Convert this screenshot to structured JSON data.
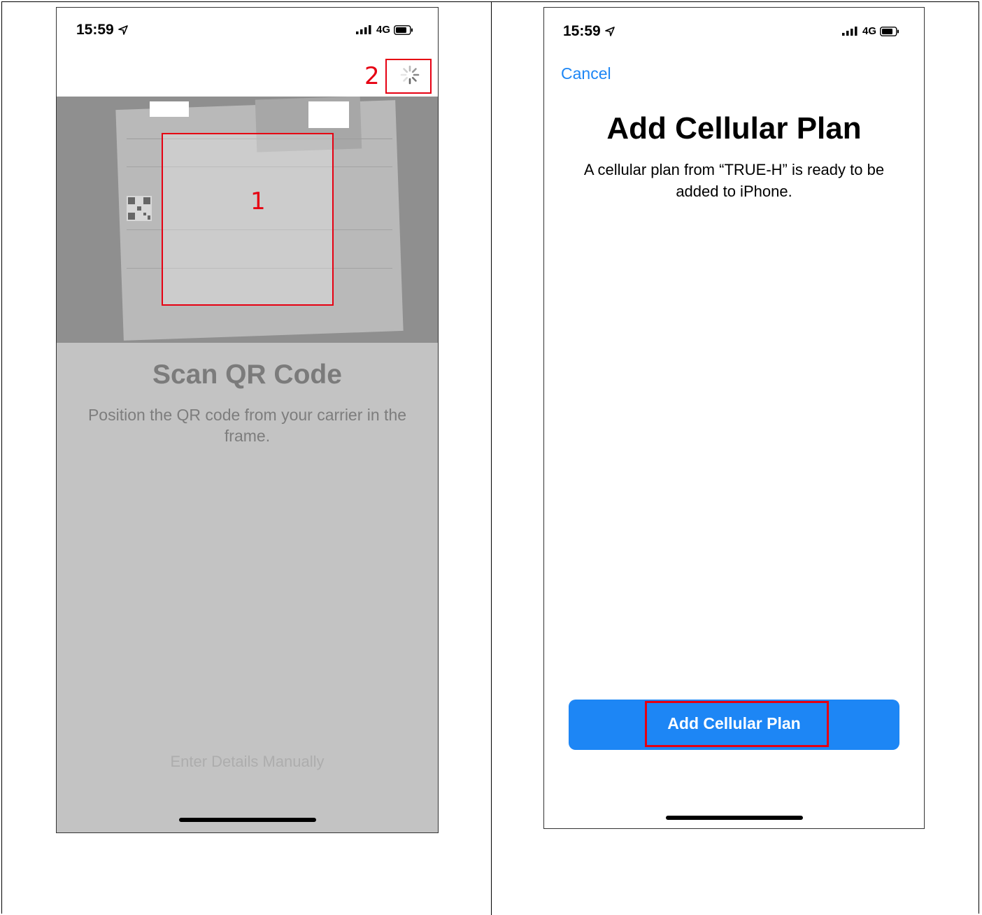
{
  "left_screen": {
    "status": {
      "time": "15:59",
      "network": "4G"
    },
    "annotation_1": "1",
    "annotation_2": "2",
    "title": "Scan QR Code",
    "subtitle": "Position the QR code from your carrier in the frame.",
    "manual_link": "Enter Details Manually"
  },
  "right_screen": {
    "status": {
      "time": "15:59",
      "network": "4G"
    },
    "cancel_label": "Cancel",
    "title": "Add Cellular Plan",
    "description": "A cellular plan from “TRUE-H” is ready to be added to iPhone.",
    "button_label": "Add Cellular Plan"
  },
  "colors": {
    "ios_blue": "#1D86F5",
    "annotation_red": "#E60012",
    "scan_overlay_gray": "#C3C3C3"
  },
  "icons": [
    "location-arrow-icon",
    "signal-bars-icon",
    "battery-icon",
    "loading-spinner-icon",
    "qr-code-icon"
  ]
}
